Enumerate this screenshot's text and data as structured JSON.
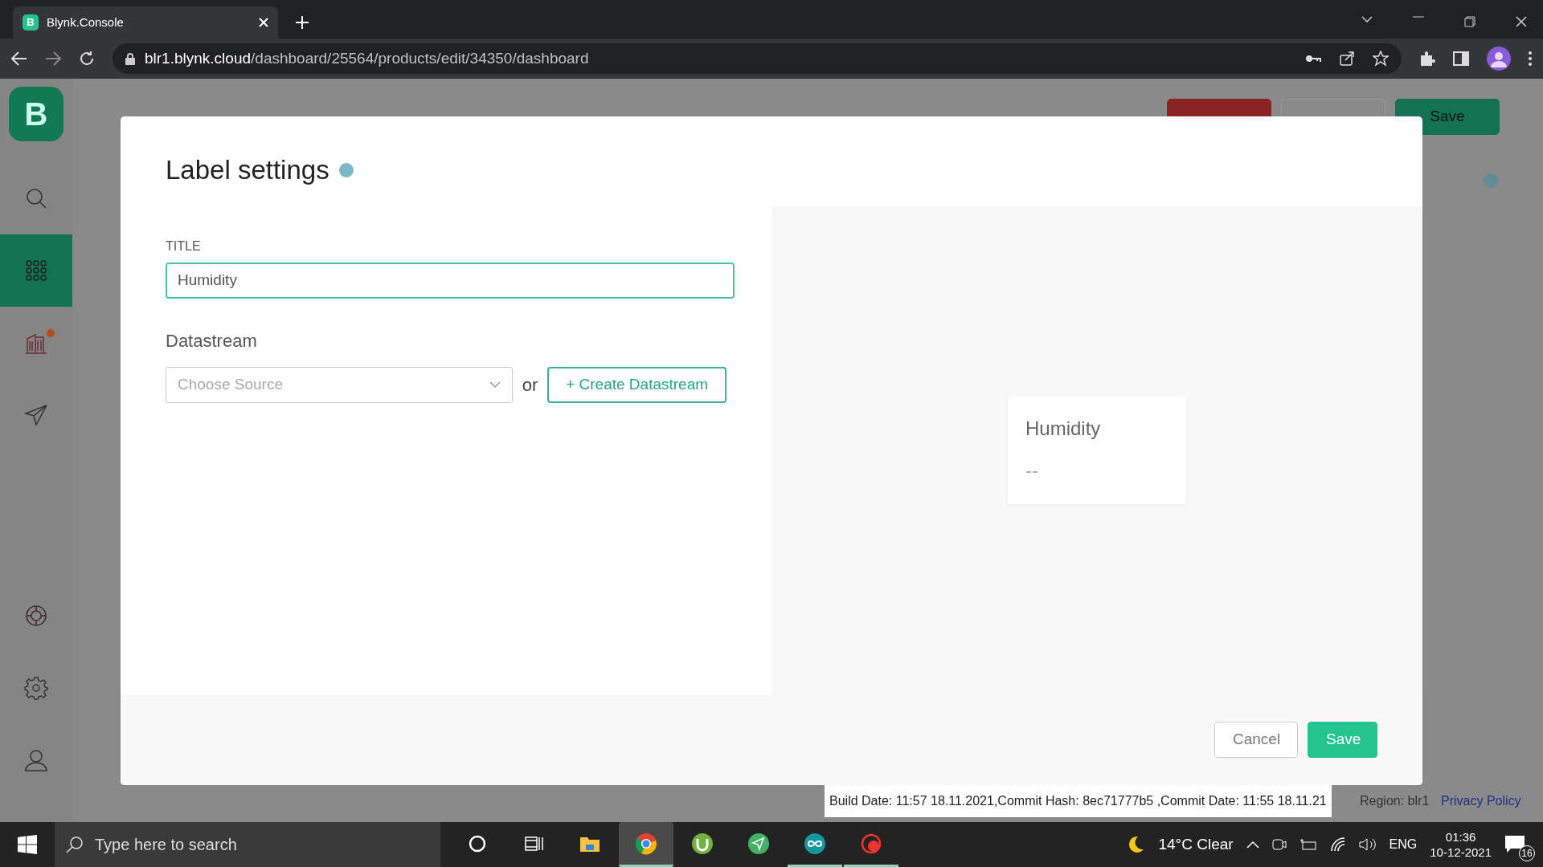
{
  "browser": {
    "favicon_letter": "B",
    "tab_title": "Blynk.Console",
    "url_host": "blr1.blynk.cloud",
    "url_path": "/dashboard/25564/products/edit/34350/dashboard"
  },
  "page": {
    "buttons": [
      {
        "kind": "danger"
      },
      {
        "kind": "outline"
      },
      {
        "label": "Save",
        "kind": "primary"
      }
    ]
  },
  "sidebar": {
    "logo": "B",
    "items": [
      {
        "kind": "search",
        "selected": false,
        "notification": false
      },
      {
        "kind": "grid",
        "selected": true,
        "notification": false
      },
      {
        "kind": "building",
        "selected": false,
        "notification": true
      },
      {
        "kind": "send",
        "selected": false,
        "notification": false
      },
      {
        "kind": "lifebuoy",
        "selected": false,
        "notification": false
      },
      {
        "kind": "settings",
        "selected": false,
        "notification": false
      },
      {
        "kind": "user",
        "selected": false,
        "notification": false
      }
    ]
  },
  "modal": {
    "title": "Label settings",
    "field_label": "TITLE",
    "title_value": "Humidity",
    "datastream_label": "Datastream",
    "source_placeholder": "Choose Source",
    "or_text": "or",
    "create_button": "+ Create Datastream",
    "preview": {
      "title": "Humidity",
      "value": "--"
    },
    "buttons": [
      {
        "label": "Cancel",
        "kind": "secondary"
      },
      {
        "label": "Save",
        "kind": "primary"
      }
    ]
  },
  "footer": {
    "build_info": "Build Date: 11:57 18.11.2021,Commit Hash: 8ec71777b5 ,Commit Date: 11:55 18.11.21",
    "region": "Region: blr1",
    "privacy_link": "Privacy Policy"
  },
  "taskbar": {
    "search_placeholder": "Type here to search",
    "apps": [
      {
        "kind": "cortana",
        "selected": false,
        "running": false
      },
      {
        "kind": "taskview",
        "selected": false,
        "running": false
      },
      {
        "kind": "explorer",
        "selected": false,
        "running": false
      },
      {
        "kind": "chrome",
        "selected": true,
        "running": true
      },
      {
        "kind": "utorrent",
        "selected": false,
        "running": false
      },
      {
        "kind": "plane",
        "selected": false,
        "running": false
      },
      {
        "kind": "infinity",
        "selected": false,
        "running": true
      },
      {
        "kind": "recorder",
        "selected": false,
        "running": true
      }
    ],
    "temperature": "14°C",
    "condition": "Clear",
    "language": "ENG",
    "time": "01:36",
    "date": "10-12-2021",
    "notifications": "16"
  }
}
